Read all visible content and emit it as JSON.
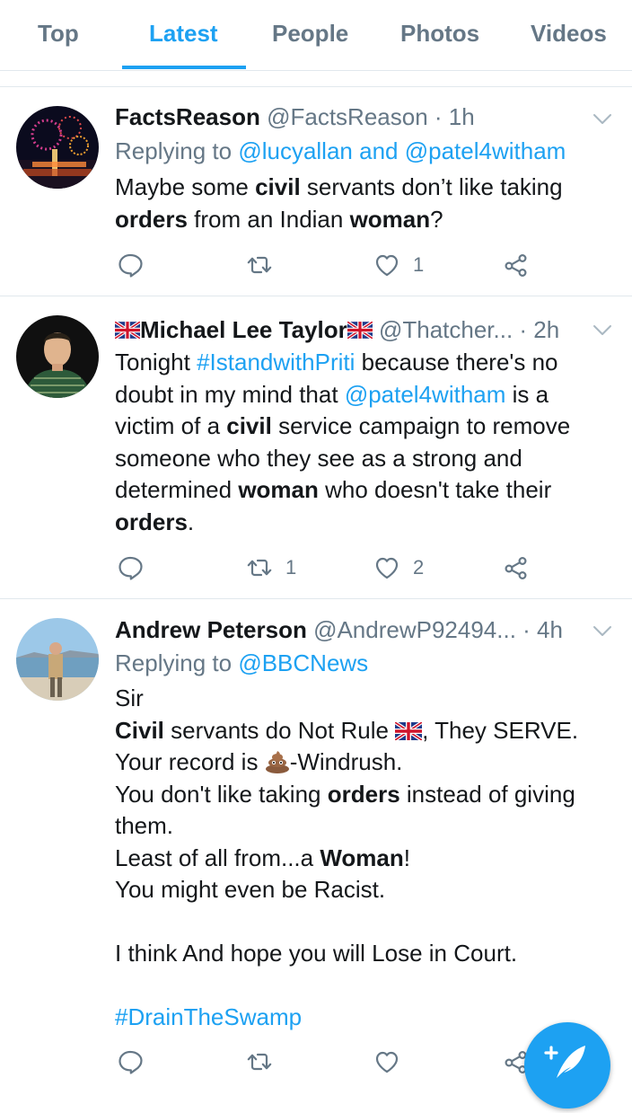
{
  "tabs": [
    {
      "label": "Top"
    },
    {
      "label": "Latest"
    },
    {
      "label": "People"
    },
    {
      "label": "Photos"
    },
    {
      "label": "Videos"
    }
  ],
  "active_tab": "Latest",
  "tweets": [
    {
      "display_name": "FactsReason",
      "handle": "@FactsReason",
      "time": "· 1h",
      "replying_prefix": "Replying to",
      "replying_to_1": "@lucyallan",
      "replying_and": "and",
      "replying_to_2": "@patel4witham",
      "text": {
        "p1": "Maybe some ",
        "b1": "civil",
        "p2": " servants don’t like taking ",
        "b2": "orders",
        "p3": " from an Indian ",
        "b3": "woman",
        "p4": "?"
      },
      "retweets": "",
      "likes": "1"
    },
    {
      "display_name": "Michael Lee Taylor",
      "handle": "@Thatcher...",
      "time": "· 2h",
      "text": {
        "p1": "Tonight ",
        "hashtag": "#IstandwithPriti",
        "p2": " because there's no doubt in my mind that ",
        "mention": "@patel4witham",
        "p3": " is a victim of a ",
        "b1": "civil",
        "p4": " service campaign to remove someone who they see as a strong and determined ",
        "b2": "woman",
        "p5": " who doesn't take their ",
        "b3": "orders",
        "p6": "."
      },
      "retweets": "1",
      "likes": "2"
    },
    {
      "display_name": "Andrew Peterson",
      "handle": "@AndrewP92494...",
      "time": "· 4h",
      "replying_prefix": "Replying to",
      "replying_to_1": "@BBCNews",
      "text": {
        "l1": "Sir",
        "l2_b": "Civil",
        "l2_rest_a": " servants do Not Rule ",
        "l2_rest_b": ", They SERVE.",
        "l3_a": "Your record is ",
        "l3_b": "-Windrush.",
        "l4_a": "You don't like taking ",
        "l4_b": "orders",
        "l4_c": " instead of giving",
        "l5": "them.",
        "l6_a": "Least of all from...a ",
        "l6_b": "Woman",
        "l6_c": "!",
        "l7": "You might even be Racist.",
        "l8": "I think And hope you will Lose in Court.",
        "hashtag": "#DrainTheSwamp"
      },
      "retweets": "",
      "likes": ""
    }
  ],
  "colors": {
    "accent": "#1da1f2",
    "secondary_text": "#657786",
    "divider": "#e1e8ed"
  },
  "icons": [
    "reply-icon",
    "retweet-icon",
    "like-icon",
    "share-icon",
    "chevron-down-icon",
    "compose-tweet-icon",
    "uk-flag-icon",
    "poop-emoji-icon"
  ]
}
